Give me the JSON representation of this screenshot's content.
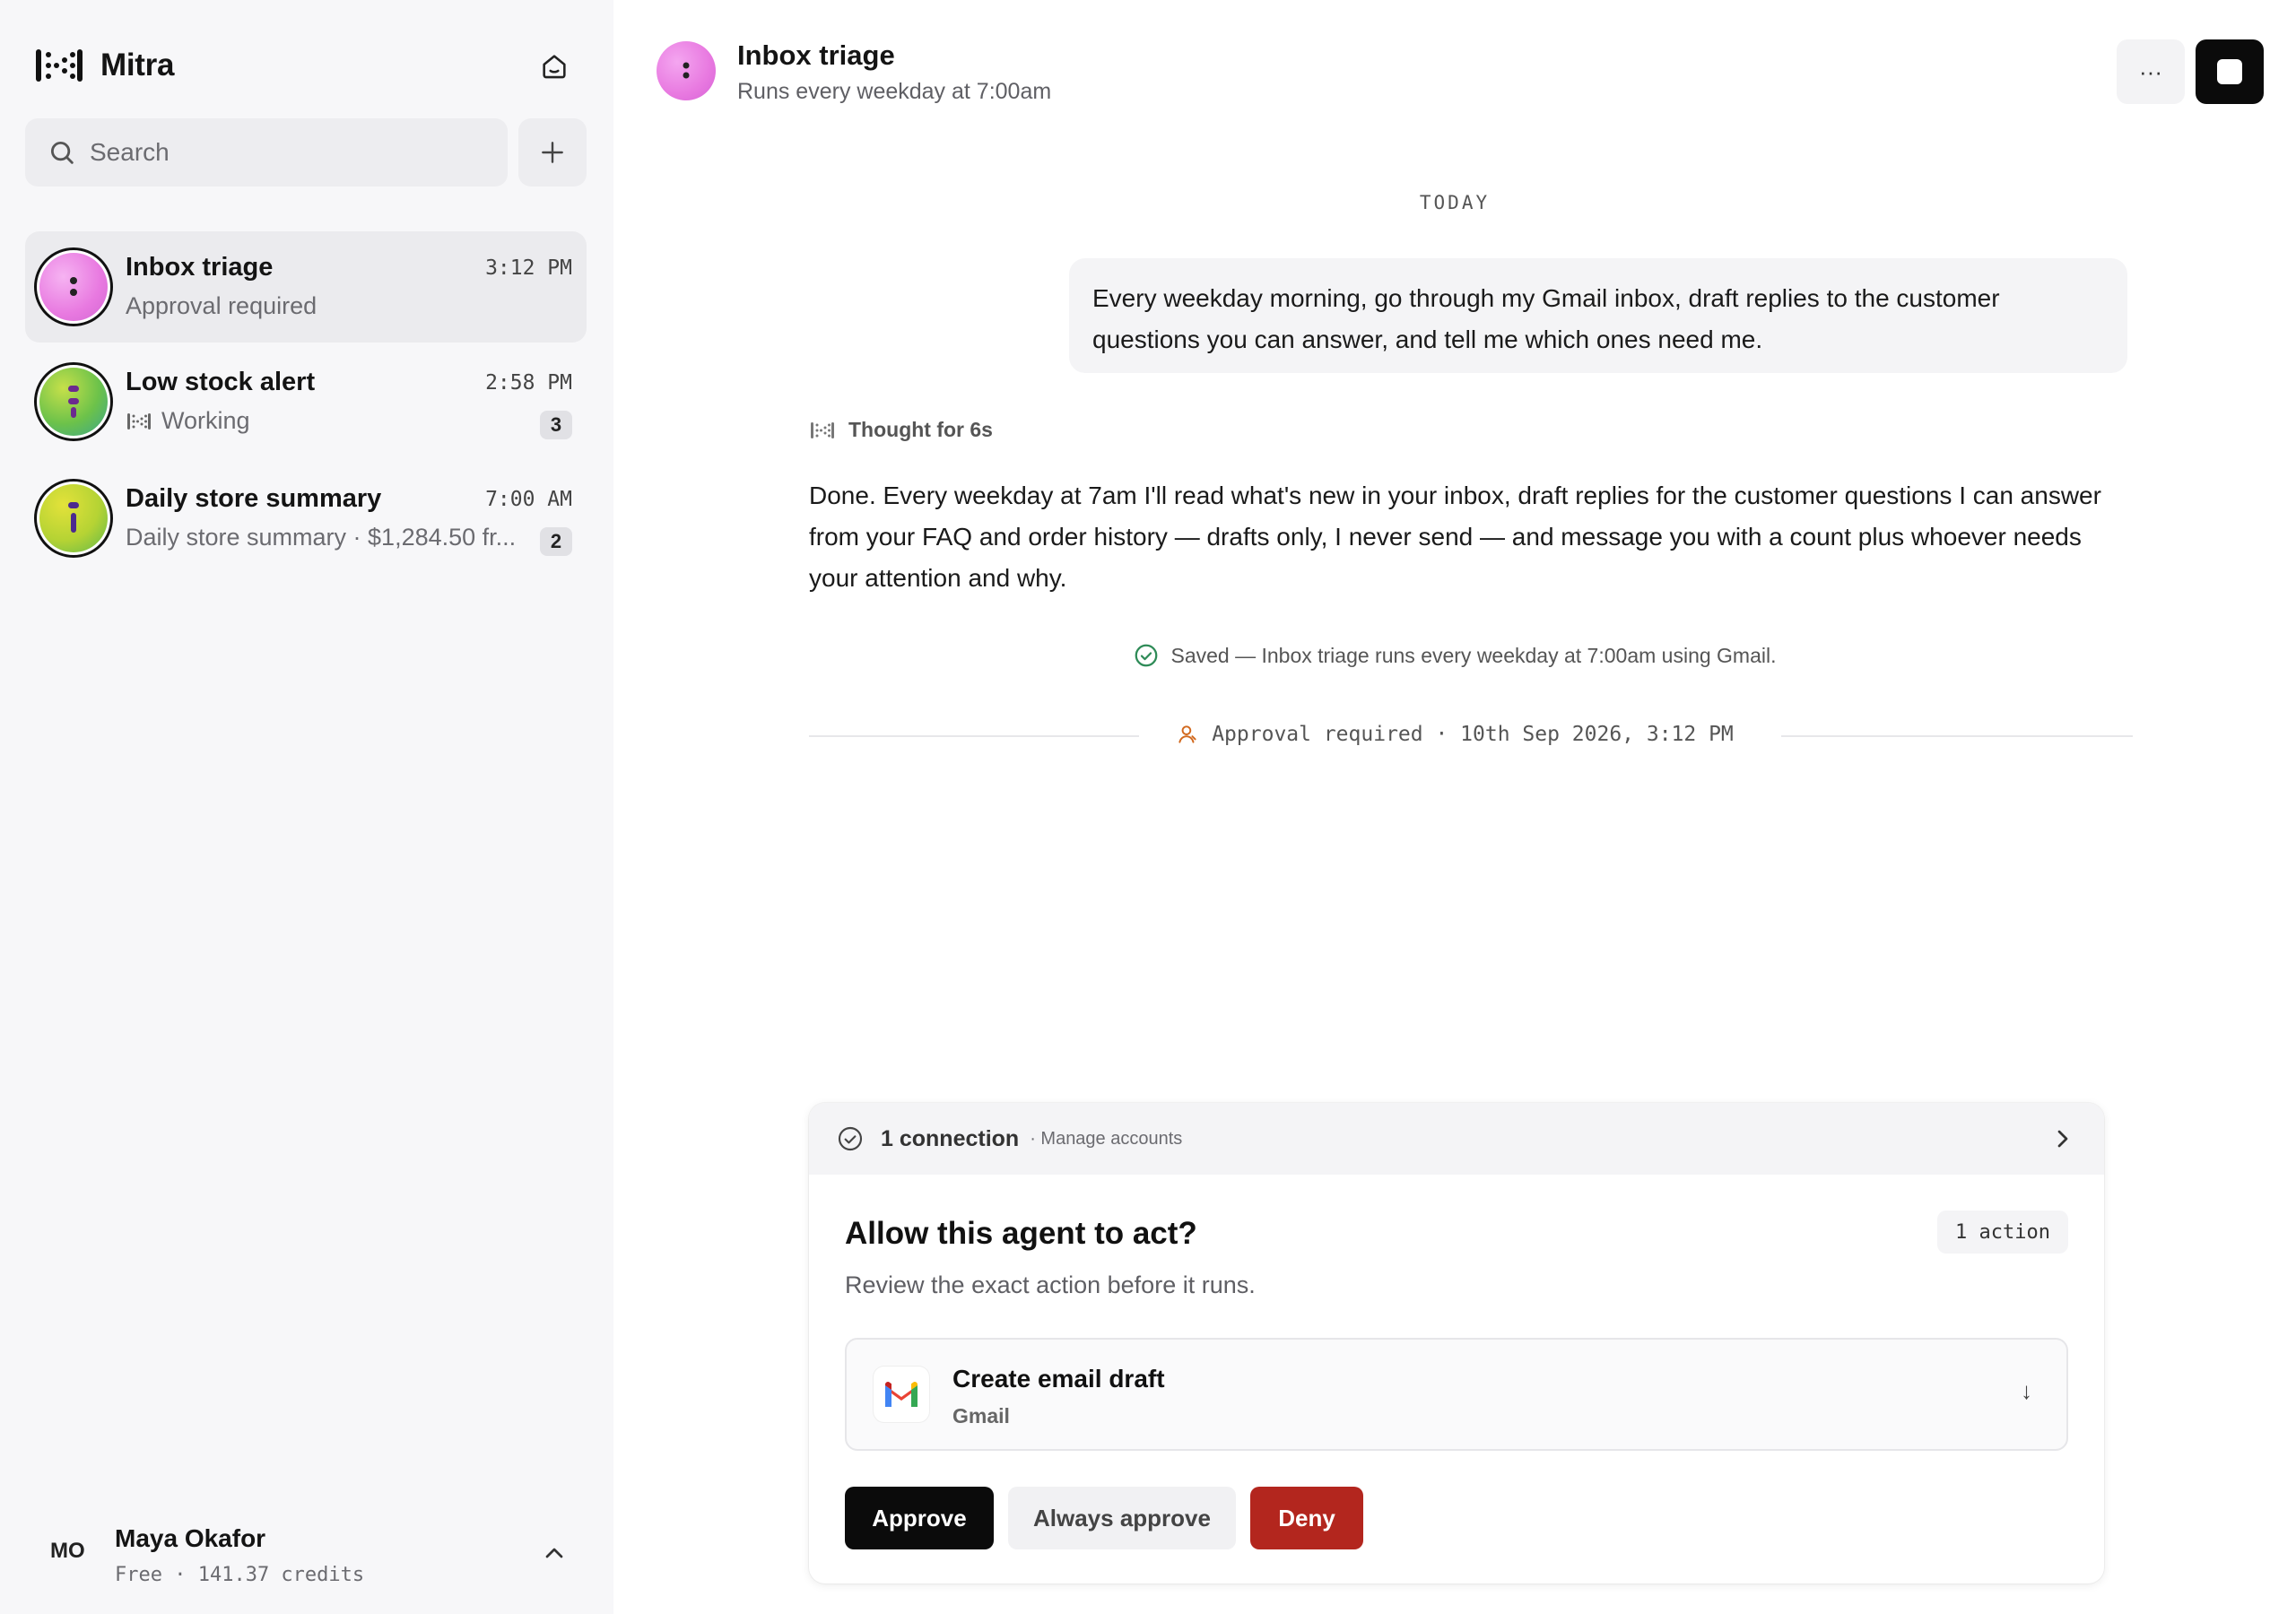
{
  "app": {
    "name": "Mitra"
  },
  "search": {
    "placeholder": "Search"
  },
  "threads": [
    {
      "title": "Inbox triage",
      "time": "3:12 PM",
      "subtitle": "Approval required",
      "badge": "",
      "avatar_color": "#e879e0"
    },
    {
      "title": "Low stock alert",
      "time": "2:58 PM",
      "subtitle": "Working",
      "badge": "3",
      "avatar_color": "#6cc24a"
    },
    {
      "title": "Daily store summary",
      "time": "7:00 AM",
      "subtitle": "Daily store summary · $1,284.50 fr...",
      "badge": "2",
      "avatar_color": "#b5d334"
    }
  ],
  "user": {
    "initials": "MO",
    "name": "Maya Okafor",
    "plan": "Free · 141.37 credits"
  },
  "header": {
    "title": "Inbox triage",
    "subtitle": "Runs every weekday at 7:00am",
    "more_label": "···"
  },
  "conversation": {
    "day_label": "TODAY",
    "user_message": "Every weekday morning, go through my Gmail inbox, draft replies to the customer questions you can answer, and tell me which ones need me.",
    "thought_label": "Thought for 6s",
    "reply": "Done. Every weekday at 7am I'll read what's new in your inbox, draft replies for the customer questions I can answer from your FAQ and order history — drafts only, I never send — and message you with a count plus whoever needs your attention and why.",
    "saved_note": "Saved — Inbox triage runs every weekday at 7:00am using Gmail.",
    "approval_marker": "Approval required · 10th Sep 2026, 3:12 PM"
  },
  "approval_card": {
    "connection_count": "1 connection",
    "manage_link": "· Manage accounts",
    "question": "Allow this agent to act?",
    "action_count": "1 action",
    "description": "Review the exact action before it runs.",
    "action": {
      "title": "Create email draft",
      "app": "Gmail",
      "arrow": "↓"
    },
    "buttons": {
      "approve": "Approve",
      "always_approve": "Always approve",
      "deny": "Deny"
    }
  },
  "colors": {
    "deny": "#b3261e",
    "approve": "#0b0b0b",
    "success": "#2e8b57",
    "warning": "#d2691e"
  }
}
